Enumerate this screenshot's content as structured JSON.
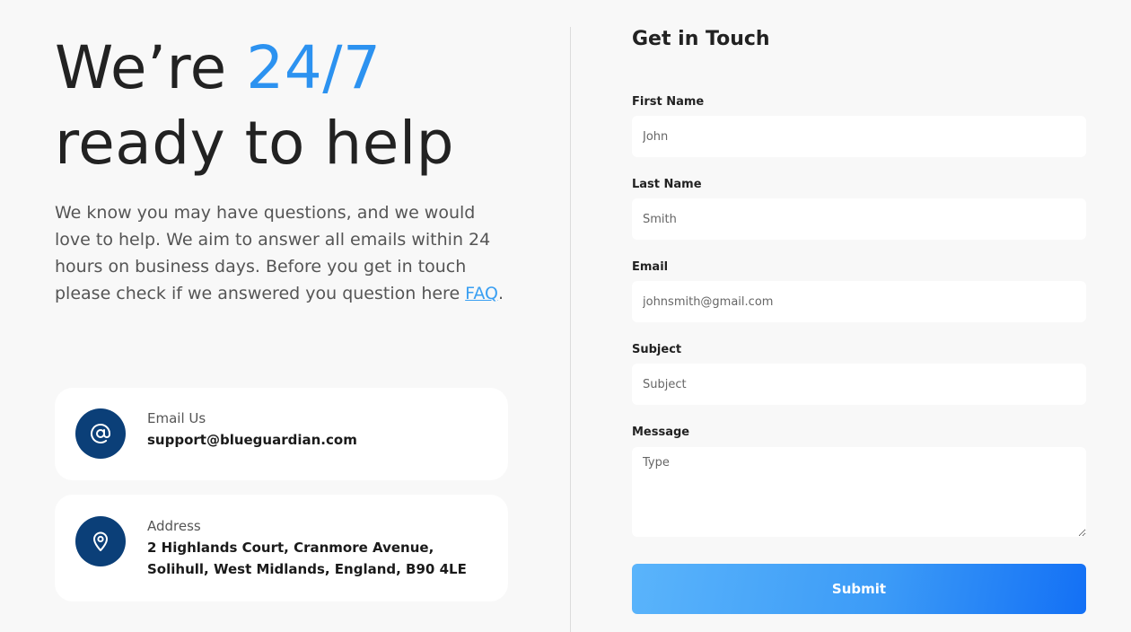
{
  "hero": {
    "headline_prefix": "We’re ",
    "headline_accent": "24/7",
    "headline_line2": "ready to help",
    "intro_text": "We know you may have questions, and we would love to help. We aim to answer all emails within 24 hours on business days. Before you get in touch please check if we answered you question here ",
    "faq_link": "FAQ",
    "intro_end": "."
  },
  "contact_cards": {
    "email": {
      "icon": "at-sign-icon",
      "label": "Email Us",
      "value": "support@blueguardian.com"
    },
    "address": {
      "icon": "location-pin-icon",
      "label": "Address",
      "line1": "2 Highlands Court, Cranmore Avenue,",
      "line2": "Solihull, West Midlands, England, B90 4LE"
    }
  },
  "form": {
    "title": "Get in Touch",
    "fields": {
      "first_name": {
        "label": "First Name",
        "placeholder": "John"
      },
      "last_name": {
        "label": "Last Name",
        "placeholder": "Smith"
      },
      "email": {
        "label": "Email",
        "placeholder": "johnsmith@gmail.com"
      },
      "subject": {
        "label": "Subject",
        "placeholder": "Subject"
      },
      "message": {
        "label": "Message",
        "placeholder": "Type"
      }
    },
    "submit_label": "Submit"
  },
  "colors": {
    "accent": "#2c92f0",
    "icon_bg": "#0b3f78",
    "button_gradient_start": "#5ab4fb",
    "button_gradient_end": "#1370f5"
  }
}
